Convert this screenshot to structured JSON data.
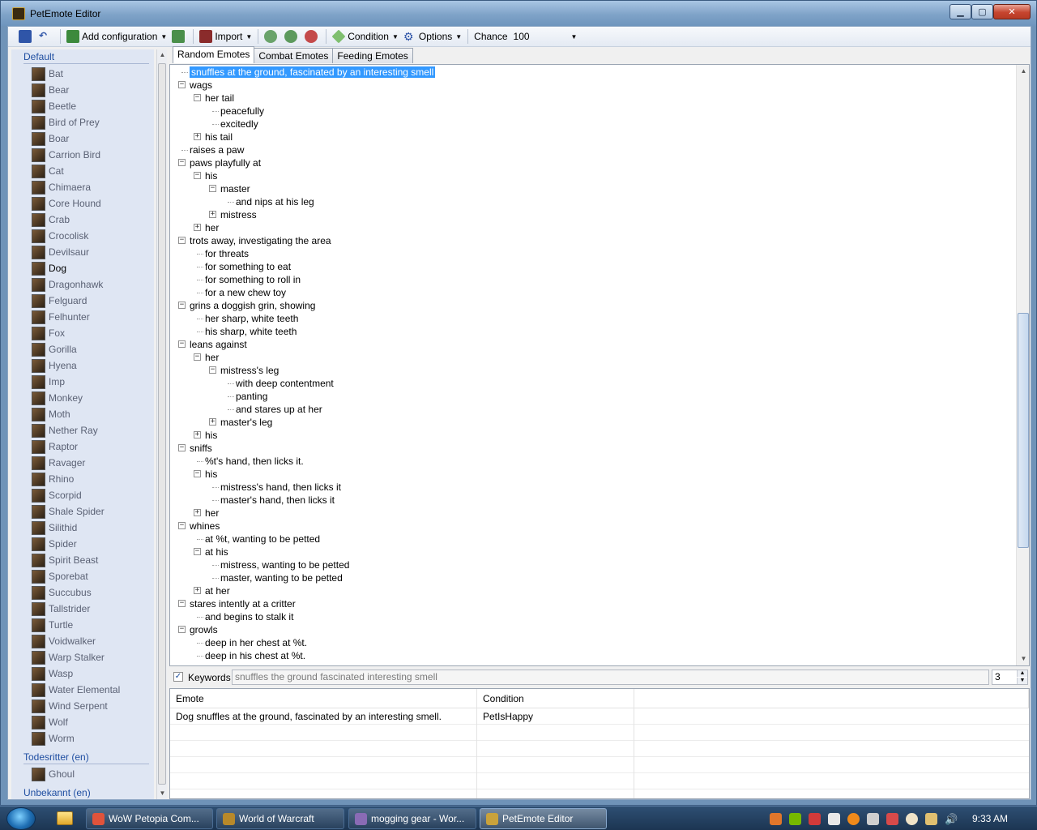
{
  "window": {
    "title": "PetEmote Editor"
  },
  "toolbar": {
    "add_configuration": "Add configuration",
    "import": "Import",
    "condition": "Condition",
    "options": "Options",
    "chance_label": "Chance",
    "chance_value": "100"
  },
  "sidebar": {
    "groups": [
      {
        "name": "Default",
        "items": [
          "Bat",
          "Bear",
          "Beetle",
          "Bird of Prey",
          "Boar",
          "Carrion Bird",
          "Cat",
          "Chimaera",
          "Core Hound",
          "Crab",
          "Crocolisk",
          "Devilsaur",
          "Dog",
          "Dragonhawk",
          "Felguard",
          "Felhunter",
          "Fox",
          "Gorilla",
          "Hyena",
          "Imp",
          "Monkey",
          "Moth",
          "Nether Ray",
          "Raptor",
          "Ravager",
          "Rhino",
          "Scorpid",
          "Shale Spider",
          "Silithid",
          "Spider",
          "Spirit Beast",
          "Sporebat",
          "Succubus",
          "Tallstrider",
          "Turtle",
          "Voidwalker",
          "Warp Stalker",
          "Wasp",
          "Water Elemental",
          "Wind Serpent",
          "Wolf",
          "Worm"
        ]
      },
      {
        "name": "Todesritter (en)",
        "items": [
          "Ghoul"
        ]
      },
      {
        "name": "Unbekannt (en)",
        "items": []
      }
    ],
    "selected": "Dog"
  },
  "tabs": [
    "Random Emotes",
    "Combat Emotes",
    "Feeding Emotes"
  ],
  "tree": {
    "nodes": [
      {
        "text": "snuffles at the ground, fascinated by an interesting smell",
        "level": 0,
        "exp": "",
        "selected": true
      },
      {
        "text": "wags",
        "level": 0,
        "exp": "-"
      },
      {
        "text": "her tail",
        "level": 1,
        "exp": "-"
      },
      {
        "text": "peacefully",
        "level": 2,
        "exp": ""
      },
      {
        "text": "excitedly",
        "level": 2,
        "exp": ""
      },
      {
        "text": "his tail",
        "level": 1,
        "exp": "+"
      },
      {
        "text": "raises a paw",
        "level": 0,
        "exp": ""
      },
      {
        "text": "paws playfully at",
        "level": 0,
        "exp": "-"
      },
      {
        "text": "his",
        "level": 1,
        "exp": "-"
      },
      {
        "text": "master",
        "level": 2,
        "exp": "-"
      },
      {
        "text": "and nips at his leg",
        "level": 3,
        "exp": ""
      },
      {
        "text": "mistress",
        "level": 2,
        "exp": "+"
      },
      {
        "text": "her",
        "level": 1,
        "exp": "+"
      },
      {
        "text": "trots away, investigating the area",
        "level": 0,
        "exp": "-"
      },
      {
        "text": "for threats",
        "level": 1,
        "exp": ""
      },
      {
        "text": "for something to eat",
        "level": 1,
        "exp": ""
      },
      {
        "text": "for something to roll in",
        "level": 1,
        "exp": ""
      },
      {
        "text": "for a new chew toy",
        "level": 1,
        "exp": ""
      },
      {
        "text": "grins a doggish grin, showing",
        "level": 0,
        "exp": "-"
      },
      {
        "text": "her sharp, white teeth",
        "level": 1,
        "exp": ""
      },
      {
        "text": "his sharp, white teeth",
        "level": 1,
        "exp": ""
      },
      {
        "text": "leans against",
        "level": 0,
        "exp": "-"
      },
      {
        "text": "her",
        "level": 1,
        "exp": "-"
      },
      {
        "text": "mistress's leg",
        "level": 2,
        "exp": "-"
      },
      {
        "text": "with deep contentment",
        "level": 3,
        "exp": ""
      },
      {
        "text": "panting",
        "level": 3,
        "exp": ""
      },
      {
        "text": "and stares up at her",
        "level": 3,
        "exp": ""
      },
      {
        "text": "master's leg",
        "level": 2,
        "exp": "+"
      },
      {
        "text": "his",
        "level": 1,
        "exp": "+"
      },
      {
        "text": "sniffs",
        "level": 0,
        "exp": "-"
      },
      {
        "text": "%t's hand, then licks it.",
        "level": 1,
        "exp": ""
      },
      {
        "text": "his",
        "level": 1,
        "exp": "-"
      },
      {
        "text": "mistress's hand, then licks it",
        "level": 2,
        "exp": ""
      },
      {
        "text": "master's hand, then licks it",
        "level": 2,
        "exp": ""
      },
      {
        "text": "her",
        "level": 1,
        "exp": "+"
      },
      {
        "text": "whines",
        "level": 0,
        "exp": "-"
      },
      {
        "text": "at %t, wanting to be petted",
        "level": 1,
        "exp": ""
      },
      {
        "text": "at his",
        "level": 1,
        "exp": "-"
      },
      {
        "text": "mistress, wanting to be petted",
        "level": 2,
        "exp": ""
      },
      {
        "text": "master, wanting to be petted",
        "level": 2,
        "exp": ""
      },
      {
        "text": "at her",
        "level": 1,
        "exp": "+"
      },
      {
        "text": "stares intently at a critter",
        "level": 0,
        "exp": "-"
      },
      {
        "text": "and begins to stalk it",
        "level": 1,
        "exp": ""
      },
      {
        "text": "growls",
        "level": 0,
        "exp": "-"
      },
      {
        "text": "deep in her chest at %t.",
        "level": 1,
        "exp": ""
      },
      {
        "text": "deep in his chest at %t.",
        "level": 1,
        "exp": ""
      }
    ]
  },
  "keywords": {
    "label": "Keywords",
    "checked": true,
    "value": "snuffles the ground fascinated interesting smell",
    "count": "3"
  },
  "grid": {
    "columns": [
      "Emote",
      "Condition"
    ],
    "rows": [
      {
        "emote": "Dog snuffles at the ground, fascinated by an interesting smell.",
        "condition": "PetIsHappy"
      }
    ]
  },
  "taskbar": {
    "tasks": [
      {
        "label": "WoW Petopia Com...",
        "color": "#e0533b"
      },
      {
        "label": "World of Warcraft",
        "color": "#b8892a"
      },
      {
        "label": "mogging gear - Wor...",
        "color": "#8a6bb5"
      },
      {
        "label": "PetEmote Editor",
        "color": "#c9a23b",
        "active": true
      }
    ],
    "clock": "9:33 AM"
  }
}
